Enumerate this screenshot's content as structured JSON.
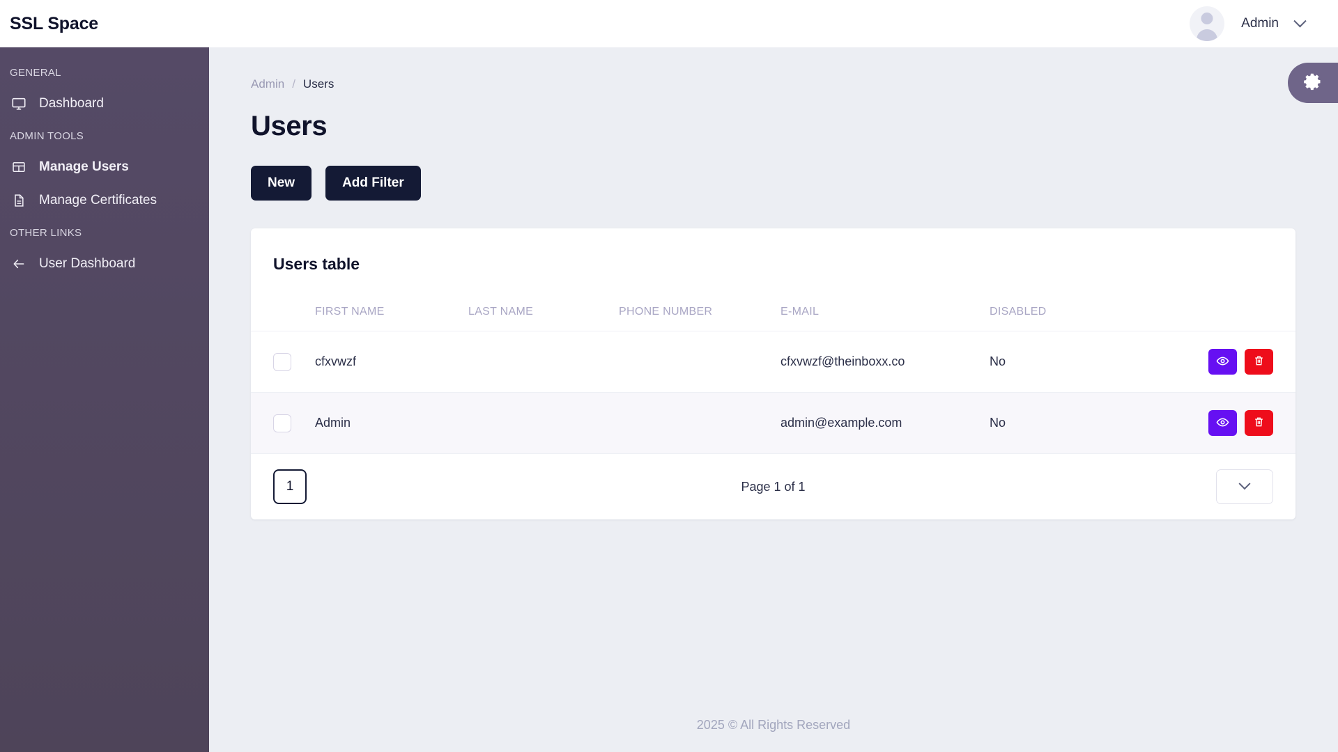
{
  "app": {
    "brand": "SSL Space",
    "accent_purple": "#6610f2",
    "accent_red": "#ee0d1b",
    "sidebar_bg": "#514761",
    "dark_button": "#141a35"
  },
  "topbar": {
    "user_name": "Admin",
    "avatar_icon": "user-avatar-icon",
    "caret_icon": "chevron-down-icon"
  },
  "sidebar": {
    "groups": [
      {
        "label": "GENERAL",
        "items": [
          {
            "label": "Dashboard",
            "icon": "monitor-icon",
            "active": false
          }
        ]
      },
      {
        "label": "ADMIN TOOLS",
        "items": [
          {
            "label": "Manage Users",
            "icon": "table-grid-icon",
            "active": true
          },
          {
            "label": "Manage Certificates",
            "icon": "document-icon",
            "active": false
          }
        ]
      },
      {
        "label": "OTHER LINKS",
        "items": [
          {
            "label": "User Dashboard",
            "icon": "arrow-left-icon",
            "active": false
          }
        ]
      }
    ]
  },
  "fab": {
    "icon": "gear-icon"
  },
  "breadcrumb": {
    "parent": "Admin",
    "separator": "/",
    "current": "Users"
  },
  "page": {
    "title": "Users"
  },
  "toolbar": {
    "new_label": "New",
    "add_filter_label": "Add Filter"
  },
  "table": {
    "title": "Users table",
    "columns": [
      "FIRST NAME",
      "LAST NAME",
      "PHONE NUMBER",
      "E-MAIL",
      "DISABLED"
    ],
    "rows": [
      {
        "first_name": "cfxvwzf",
        "last_name": "",
        "phone_number": "",
        "email": "cfxvwzf@theinboxx.co",
        "disabled": "No",
        "view_icon": "eye-icon",
        "delete_icon": "trash-icon"
      },
      {
        "first_name": "Admin",
        "last_name": "",
        "phone_number": "",
        "email": "admin@example.com",
        "disabled": "No",
        "view_icon": "eye-icon",
        "delete_icon": "trash-icon"
      }
    ]
  },
  "pagination": {
    "current_page": "1",
    "page_info": "Page 1 of 1",
    "per_page_value": "",
    "chevron_icon": "chevron-down-icon"
  },
  "footer": {
    "text": "2025 © All Rights Reserved"
  }
}
